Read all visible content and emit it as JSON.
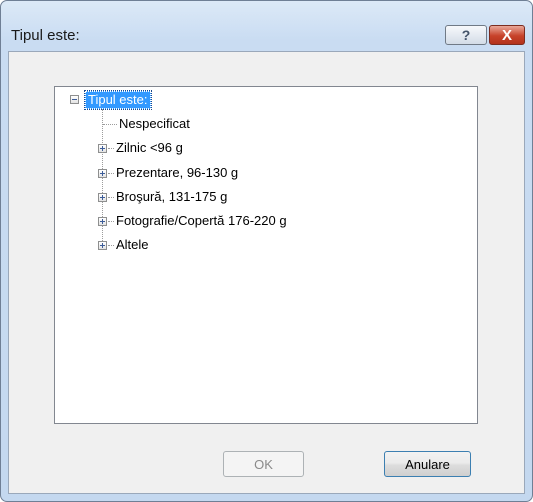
{
  "window": {
    "title": "Tipul este:",
    "help_label": "?",
    "close_label": "X"
  },
  "tree": {
    "root_label": "Tipul este:",
    "root_expanded": true,
    "items": [
      {
        "label": "Nespecificat",
        "has_children": false
      },
      {
        "label": "Zilnic <96 g",
        "has_children": true
      },
      {
        "label": "Prezentare, 96-130 g",
        "has_children": true
      },
      {
        "label": "Broşură, 131-175 g",
        "has_children": true
      },
      {
        "label": "Fotografie/Copertă 176-220 g",
        "has_children": true
      },
      {
        "label": "Altele",
        "has_children": true
      }
    ]
  },
  "buttons": {
    "ok_label": "OK",
    "ok_enabled": false,
    "cancel_label": "Anulare"
  },
  "colors": {
    "selection": "#3399ff",
    "close_button": "#c7422a",
    "window_frame": "#c4d8ef"
  }
}
